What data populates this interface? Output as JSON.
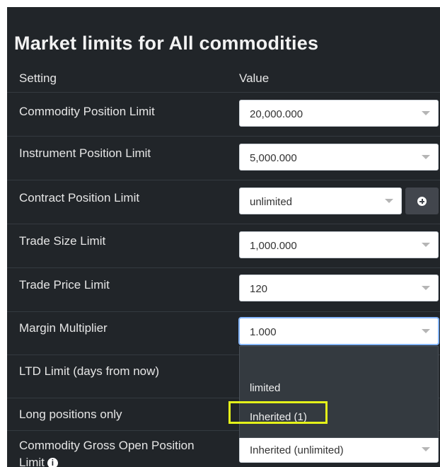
{
  "title": "Market limits for All commodities",
  "table": {
    "header_setting": "Setting",
    "header_value": "Value",
    "rows": [
      {
        "label": "Commodity Position Limit",
        "value": "20,000.000"
      },
      {
        "label": "Instrument Position Limit",
        "value": "5,000.000"
      },
      {
        "label": "Contract Position Limit",
        "value": "unlimited"
      },
      {
        "label": "Trade Size Limit",
        "value": "1,000.000"
      },
      {
        "label": "Trade Price Limit",
        "value": "120"
      },
      {
        "label": "Margin Multiplier",
        "value": "1.000"
      },
      {
        "label": "LTD Limit (days from now)",
        "value": ""
      },
      {
        "label": "Long positions only",
        "value": ""
      },
      {
        "label": "Commodity Gross Open Position Limit",
        "value": "Inherited (unlimited)"
      }
    ]
  },
  "dropdown": {
    "options": [
      "limited",
      "Inherited (1)"
    ],
    "highlighted": "Inherited (1)"
  },
  "icons": {
    "add": "plus-circle-icon",
    "info": "info-icon",
    "caret": "chevron-down-icon"
  },
  "info_icon_glyph": "i",
  "colors": {
    "panel_bg": "#212529",
    "highlight": "#e4f21a",
    "focus": "#86b7fe"
  }
}
